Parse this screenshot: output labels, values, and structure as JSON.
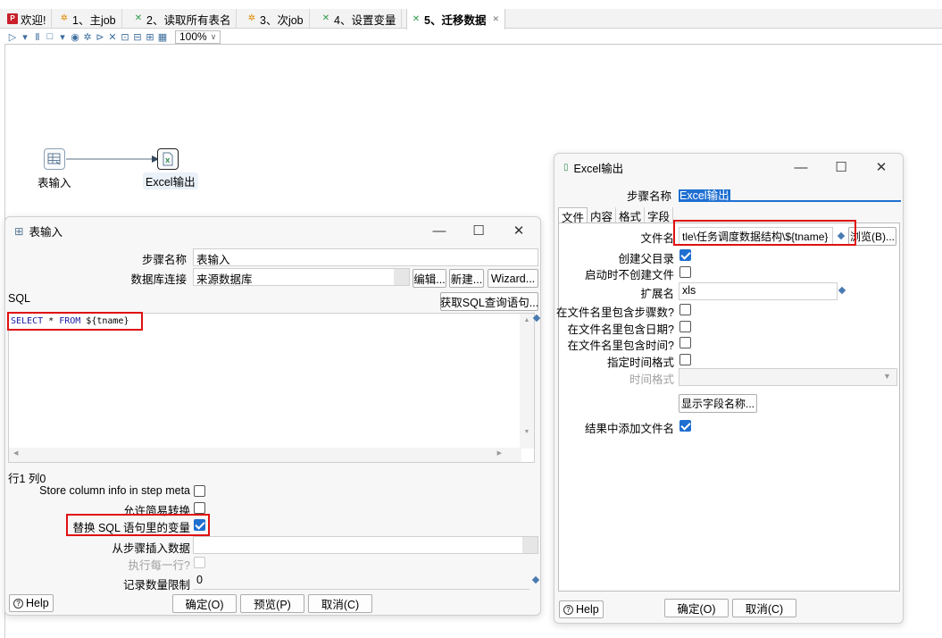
{
  "tabs": [
    {
      "label": "欢迎!",
      "icon": "welcome-icon"
    },
    {
      "label": "1、主job",
      "icon": "job-icon"
    },
    {
      "label": "2、读取所有表名",
      "icon": "transformation-icon"
    },
    {
      "label": "3、次job",
      "icon": "job-icon"
    },
    {
      "label": "4、设置变量",
      "icon": "transformation-icon"
    },
    {
      "label": "5、迁移数据",
      "icon": "transformation-icon",
      "active": true
    }
  ],
  "toolbar": {
    "zoom": "100%"
  },
  "canvas": {
    "steps": [
      {
        "label": "表输入"
      },
      {
        "label": "Excel输出"
      }
    ]
  },
  "table_input_dialog": {
    "title": "表输入",
    "step_name_label": "步骤名称",
    "step_name_value": "表输入",
    "db_conn_label": "数据库连接",
    "db_conn_value": "来源数据库",
    "edit_button": "编辑...",
    "new_button": "新建...",
    "wizard_button": "Wizard...",
    "sql_label": "SQL",
    "get_sql_button": "获取SQL查询语句...",
    "sql_keyword1": "SELECT",
    "sql_rest": " * ",
    "sql_keyword2": "FROM",
    "sql_var": " ${tname}",
    "cursor_pos": "行1 列0",
    "store_column_info_label": "Store column info in step meta",
    "store_column_info_checked": false,
    "lazy_conversion_label": "允许简易转换",
    "lazy_conversion_checked": false,
    "replace_vars_label": "替换 SQL 语句里的变量",
    "replace_vars_checked": true,
    "insert_from_step_label": "从步骤插入数据",
    "insert_from_step_value": "",
    "execute_each_row_label": "执行每一行?",
    "limit_label": "记录数量限制",
    "limit_value": "0",
    "help_button": "Help",
    "ok_button": "确定(O)",
    "preview_button": "预览(P)",
    "cancel_button": "取消(C)"
  },
  "excel_output_dialog": {
    "title": "Excel输出",
    "step_name_label": "步骤名称",
    "step_name_value": "Excel输出",
    "tabs": [
      "文件",
      "内容",
      "格式",
      "字段"
    ],
    "filename_label": "文件名",
    "filename_value": "tle\\任务调度数据结构\\${tname}",
    "browse_button": "浏览(B)...",
    "create_parent_label": "创建父目录",
    "create_parent_checked": true,
    "no_create_on_start_label": "启动时不创建文件",
    "no_create_on_start_checked": false,
    "extension_label": "扩展名",
    "extension_value": "xls",
    "include_stepnr_label": "在文件名里包含步骤数?",
    "include_date_label": "在文件名里包含日期?",
    "include_time_label": "在文件名里包含时间?",
    "specify_format_label": "指定时间格式",
    "time_format_label": "时间格式",
    "show_fields_button": "显示字段名称...",
    "add_to_result_label": "结果中添加文件名",
    "add_to_result_checked": true,
    "help_button": "Help",
    "ok_button": "确定(O)",
    "cancel_button": "取消(C)"
  },
  "colors": {
    "highlight": "#e01010",
    "checkbox_on": "#1f6fd1",
    "sql_keyword": "#1a1aa6"
  }
}
